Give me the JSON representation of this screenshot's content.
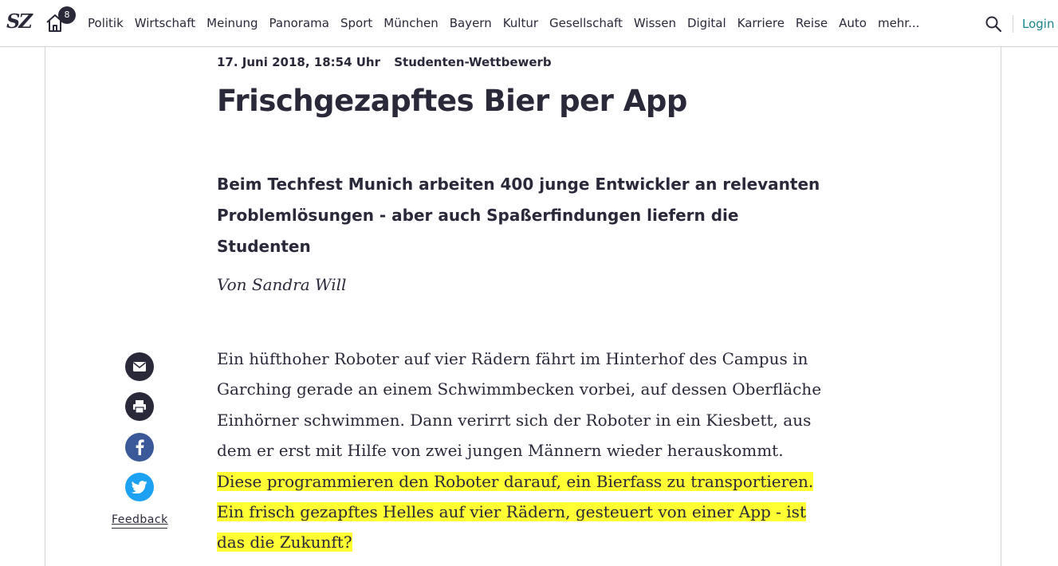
{
  "header": {
    "logo": "SZ",
    "home_badge_count": "8",
    "nav_items": [
      "Politik",
      "Wirtschaft",
      "Meinung",
      "Panorama",
      "Sport",
      "München",
      "Bayern",
      "Kultur",
      "Gesellschaft",
      "Wissen",
      "Digital",
      "Karriere",
      "Reise",
      "Auto",
      "mehr..."
    ],
    "login_label": "Login"
  },
  "article": {
    "date": "17. Juni 2018, 18:54 Uhr",
    "kicker": "Studenten-Wettbewerb",
    "headline": "Frischgezapftes Bier per App",
    "teaser": "Beim Techfest Munich arbeiten 400 junge Entwickler an relevanten Problemlösungen - aber auch Spaßerfindungen liefern die Studenten",
    "author": "Von Sandra Will",
    "body_plain": "Ein hüfthoher Roboter auf vier Rädern fährt im Hinterhof des Campus in Garching gerade an einem Schwimmbecken vorbei, auf dessen Oberfläche Einhörner schwimmen. Dann verirrt sich der Roboter in ein Kiesbett, aus dem er erst mit Hilfe von zwei jungen Männern wieder herauskommt. ",
    "body_highlighted": "Diese programmieren den Roboter darauf, ein Bierfass zu transportieren. Ein frisch gezapftes Helles auf vier Rädern, gesteuert von einer App - ist das die Zukunft?"
  },
  "sidebar": {
    "share_icons": [
      "mail-icon",
      "print-icon",
      "facebook-icon",
      "twitter-icon"
    ],
    "feedback_label": "Feedback"
  },
  "colors": {
    "text": "#29293a",
    "accent": "#188489",
    "highlight": "#ffff33",
    "facebook": "#3b5998",
    "twitter": "#1da1f2"
  }
}
